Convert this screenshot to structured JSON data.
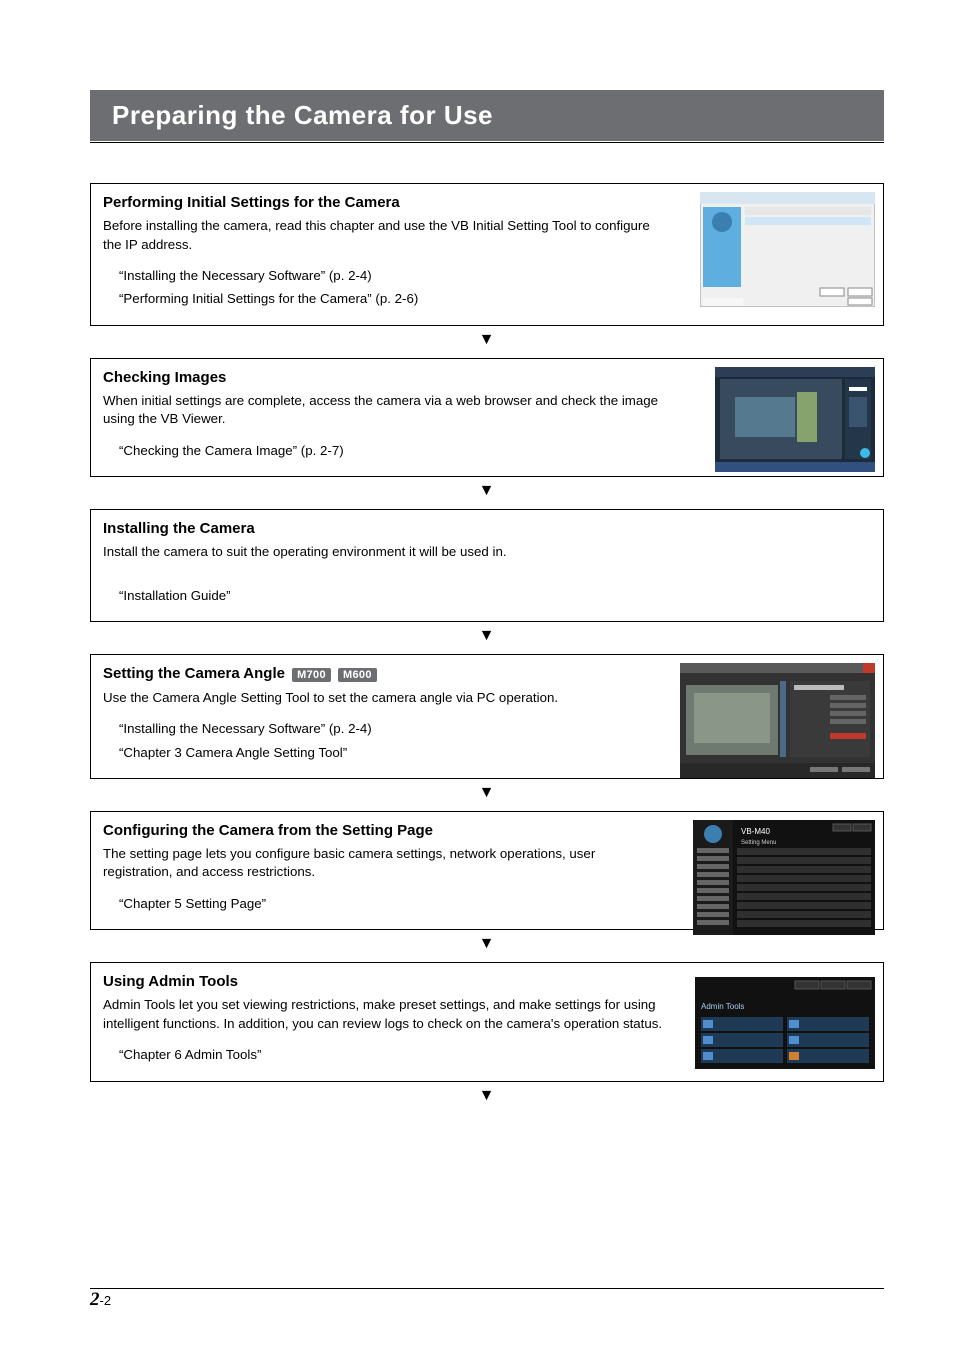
{
  "page_title": "Preparing the Camera for Use",
  "sections": [
    {
      "heading": "Performing Initial Settings for the Camera",
      "body": "Before installing the camera, read this chapter and use the VB Initial Setting Tool to configure the IP address.",
      "refs": [
        "“Installing the Necessary Software” (p. 2-4)",
        "“Performing Initial Settings for the Camera” (p. 2-6)"
      ]
    },
    {
      "heading": "Checking Images",
      "body": "When initial settings are complete, access the camera via a web browser and check the image using the VB Viewer.",
      "refs": [
        "“Checking the Camera Image” (p. 2-7)"
      ]
    },
    {
      "heading": "Installing the Camera",
      "body": "Install the camera to suit the operating environment it will be used in.",
      "refs": [
        "“Installation Guide”"
      ]
    },
    {
      "heading": "Setting the Camera Angle",
      "badges": [
        "M700",
        "M600"
      ],
      "body": "Use the Camera Angle Setting Tool to set the camera angle via PC operation.",
      "refs": [
        "“Installing the Necessary Software” (p. 2-4)",
        "“Chapter 3 Camera Angle Setting Tool”"
      ]
    },
    {
      "heading": "Configuring the Camera from the Setting Page",
      "body": "The setting page lets you configure basic camera settings, network operations, user registration, and access restrictions.",
      "refs": [
        "“Chapter 5 Setting Page”"
      ]
    },
    {
      "heading": "Using Admin Tools",
      "body": "Admin Tools let you set viewing restrictions, make preset settings, and make settings for using intelligent functions. In addition, you can review logs to check on the camera's operation status.",
      "refs": [
        "“Chapter 6 Admin Tools”"
      ]
    }
  ],
  "page_number_big": "2",
  "page_number_small": "-2",
  "thumb_labels": {
    "setting_menu_title": "VB-M40",
    "setting_menu_sub": "Setting Menu",
    "admin_tools_title": "Admin Tools"
  }
}
